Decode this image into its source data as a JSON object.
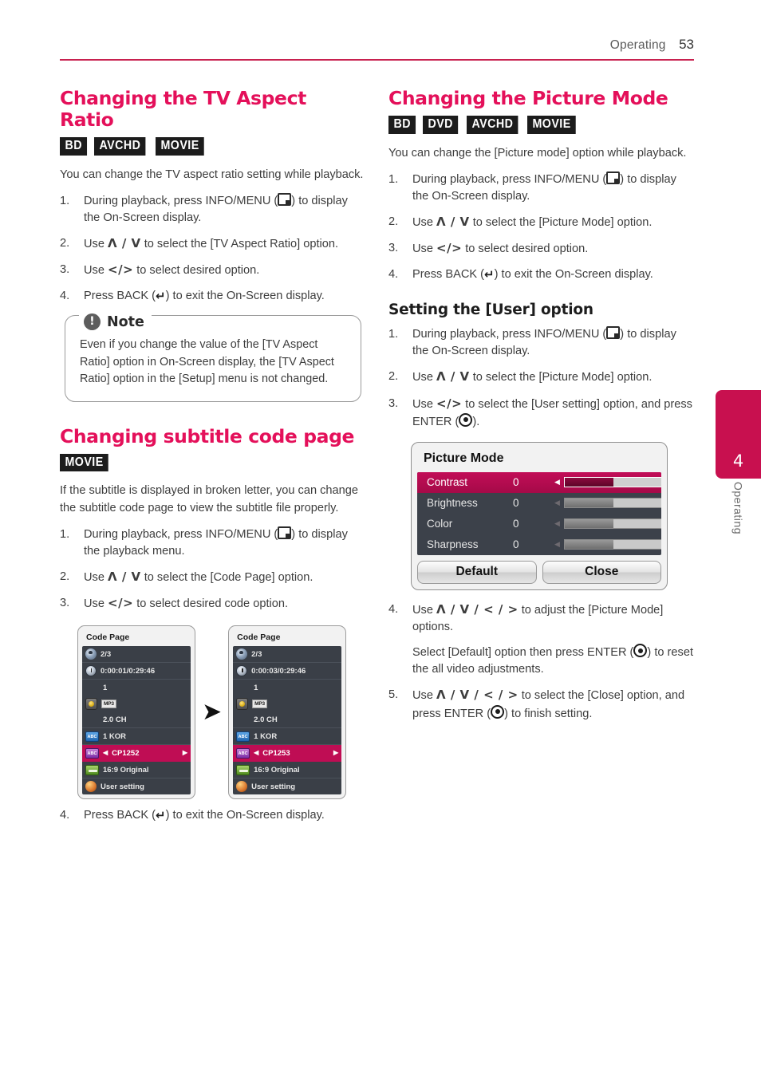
{
  "header": {
    "section": "Operating",
    "page_number": "53",
    "rule_color": "#c8214f"
  },
  "side_tab": {
    "number": "4",
    "label": "Operating",
    "color": "#c8104f"
  },
  "left_column": {
    "section1": {
      "title": "Changing the TV Aspect Ratio",
      "badges": [
        "BD",
        "AVCHD",
        "MOVIE"
      ],
      "intro": "You can change the TV aspect ratio setting while playback.",
      "steps": [
        {
          "num": "1.",
          "pre": "During playback, press INFO/MENU (",
          "post": ") to display the On-Screen display.",
          "icon": "menu-icon"
        },
        {
          "num": "2.",
          "pre": "Use ",
          "keys": "Λ / V",
          "post": " to select the [TV Aspect Ratio] option."
        },
        {
          "num": "3.",
          "pre": "Use ",
          "keys": "</>",
          "post": " to select desired option."
        },
        {
          "num": "4.",
          "pre": "Press BACK (",
          "post": ") to exit the On-Screen display.",
          "icon": "back-icon"
        }
      ],
      "note": {
        "title": "Note",
        "icon": "exclamation-icon",
        "text": "Even if you change the value of the [TV Aspect Ratio] option in On-Screen display, the [TV Aspect Ratio] option in the [Setup] menu is not changed."
      }
    },
    "section2": {
      "title": "Changing subtitle code page",
      "badges": [
        "MOVIE"
      ],
      "intro": "If the subtitle is displayed in broken letter, you can change the subtitle code page to view the subtitle file properly.",
      "steps": [
        {
          "num": "1.",
          "pre": "During playback, press INFO/MENU (",
          "post": ") to display the playback menu.",
          "icon": "menu-icon"
        },
        {
          "num": "2.",
          "pre": "Use ",
          "keys": "Λ / V",
          "post": " to select the [Code Page] option."
        },
        {
          "num": "3.",
          "pre": "Use ",
          "keys": "</>",
          "post": " to select desired code option."
        }
      ],
      "final_step": {
        "num": "4.",
        "pre": "Press BACK (",
        "post": ") to exit the On-Screen display.",
        "icon": "back-icon"
      },
      "osd_before": {
        "title": "Code Page",
        "rows": [
          {
            "icon": "disc-icon",
            "label": "2/3",
            "selected": false
          },
          {
            "icon": "clock-icon",
            "label": "0:00:01/0:29:46",
            "selected": false
          },
          {
            "icon": "blank-icon",
            "label": "1",
            "selected": false,
            "group": true
          },
          {
            "icon": "audio-icon",
            "label": "MP3",
            "tag": true,
            "selected": false,
            "group": true
          },
          {
            "icon": "blank-icon",
            "label": "2.0 CH",
            "selected": false
          },
          {
            "icon": "subtitle-abc-icon",
            "label": "1 KOR",
            "selected": false
          },
          {
            "icon": "codepage-icon",
            "label": "CP1252",
            "selected": true,
            "arrows": true
          },
          {
            "icon": "screen-ratio-icon",
            "label": "16:9 Original",
            "selected": false
          },
          {
            "icon": "palette-icon",
            "label": "User setting",
            "selected": false
          }
        ]
      },
      "osd_after": {
        "title": "Code Page",
        "rows": [
          {
            "icon": "disc-icon",
            "label": "2/3",
            "selected": false
          },
          {
            "icon": "clock-icon",
            "label": "0:00:03/0:29:46",
            "selected": false
          },
          {
            "icon": "blank-icon",
            "label": "1",
            "selected": false,
            "group": true
          },
          {
            "icon": "audio-icon",
            "label": "MP3",
            "tag": true,
            "selected": false,
            "group": true
          },
          {
            "icon": "blank-icon",
            "label": "2.0 CH",
            "selected": false
          },
          {
            "icon": "subtitle-abc-icon",
            "label": "1 KOR",
            "selected": false
          },
          {
            "icon": "codepage-icon",
            "label": "CP1253",
            "selected": true,
            "arrows": true
          },
          {
            "icon": "screen-ratio-icon",
            "label": "16:9 Original",
            "selected": false
          },
          {
            "icon": "palette-icon",
            "label": "User setting",
            "selected": false
          }
        ]
      },
      "flow_arrow": "➤"
    }
  },
  "right_column": {
    "section1": {
      "title": "Changing the Picture Mode",
      "badges": [
        "BD",
        "DVD",
        "AVCHD",
        "MOVIE"
      ],
      "intro": "You can change the [Picture mode] option while playback.",
      "steps": [
        {
          "num": "1.",
          "pre": "During playback, press INFO/MENU (",
          "post": ") to display the On-Screen display.",
          "icon": "menu-icon"
        },
        {
          "num": "2.",
          "pre": "Use ",
          "keys": "Λ / V",
          "post": " to select the [Picture Mode] option."
        },
        {
          "num": "3.",
          "pre": "Use ",
          "keys": "</>",
          "post": " to select desired option."
        },
        {
          "num": "4.",
          "pre": "Press BACK (",
          "post": ") to exit the On-Screen display.",
          "icon": "back-icon"
        }
      ]
    },
    "section2": {
      "title": "Setting the [User] option",
      "steps": [
        {
          "num": "1.",
          "pre": "During playback, press INFO/MENU (",
          "post": ") to display the On-Screen display.",
          "icon": "menu-icon"
        },
        {
          "num": "2.",
          "pre": "Use ",
          "keys": "Λ / V",
          "post": " to select the [Picture Mode] option."
        },
        {
          "num": "3.",
          "pre": "Use ",
          "keys": "</>",
          "post": " to select the [User setting] option, and press ENTER (",
          "post2": ").",
          "icon": "enter-icon"
        }
      ],
      "steps_after": [
        {
          "num": "4.",
          "pre": "Use ",
          "keys": "Λ / V / < / >",
          "post": " to adjust the [Picture Mode] options.",
          "cont_pre": "Select [Default] option then press ENTER (",
          "cont_post": ") to reset the all video adjustments.",
          "icon": "enter-icon"
        },
        {
          "num": "5.",
          "pre": "Use ",
          "keys": "Λ / V / < / >",
          "post": " to select the [Close] option, and press ENTER (",
          "post2": ") to finish setting.",
          "icon": "enter-icon"
        }
      ]
    },
    "picture_mode_osd": {
      "title": "Picture Mode",
      "rows": [
        {
          "name": "Contrast",
          "value": "0",
          "fill_percent": 50,
          "selected": true
        },
        {
          "name": "Brightness",
          "value": "0",
          "fill_percent": 50,
          "selected": false
        },
        {
          "name": "Color",
          "value": "0",
          "fill_percent": 50,
          "selected": false
        },
        {
          "name": "Sharpness",
          "value": "0",
          "fill_percent": 50,
          "selected": false
        }
      ],
      "buttons": [
        "Default",
        "Close"
      ],
      "accent_color": "#c20d57"
    }
  }
}
